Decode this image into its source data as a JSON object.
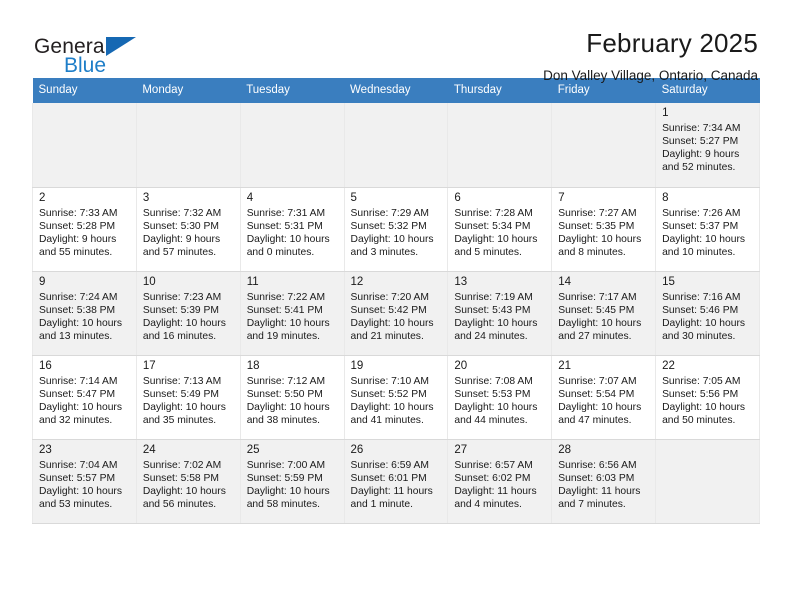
{
  "brand": {
    "name_part1": "General",
    "name_part2": "Blue",
    "accent_color": "#1668b3",
    "logo_icon": "triangle-logo-icon"
  },
  "header": {
    "title": "February 2025",
    "subtitle": "Don Valley Village, Ontario, Canada"
  },
  "theme": {
    "header_row_bg": "#3a7ebf",
    "header_row_text": "#ffffff",
    "row_shaded_bg": "#f1f1f1",
    "row_plain_bg": "#ffffff",
    "grid_border": "#d9d9d9"
  },
  "weekday_headers": [
    "Sunday",
    "Monday",
    "Tuesday",
    "Wednesday",
    "Thursday",
    "Friday",
    "Saturday"
  ],
  "calendar": {
    "month": "February",
    "year": "2025",
    "labels": {
      "sunrise": "Sunrise:",
      "sunset": "Sunset:",
      "daylight": "Daylight:"
    },
    "weeks": [
      {
        "shaded": true,
        "days": [
          {
            "day": "",
            "detail": ""
          },
          {
            "day": "",
            "detail": ""
          },
          {
            "day": "",
            "detail": ""
          },
          {
            "day": "",
            "detail": ""
          },
          {
            "day": "",
            "detail": ""
          },
          {
            "day": "",
            "detail": ""
          },
          {
            "day": "1",
            "detail": "Sunrise: 7:34 AM\nSunset: 5:27 PM\nDaylight: 9 hours\nand 52 minutes."
          }
        ]
      },
      {
        "shaded": false,
        "days": [
          {
            "day": "2",
            "detail": "Sunrise: 7:33 AM\nSunset: 5:28 PM\nDaylight: 9 hours\nand 55 minutes."
          },
          {
            "day": "3",
            "detail": "Sunrise: 7:32 AM\nSunset: 5:30 PM\nDaylight: 9 hours\nand 57 minutes."
          },
          {
            "day": "4",
            "detail": "Sunrise: 7:31 AM\nSunset: 5:31 PM\nDaylight: 10 hours\nand 0 minutes."
          },
          {
            "day": "5",
            "detail": "Sunrise: 7:29 AM\nSunset: 5:32 PM\nDaylight: 10 hours\nand 3 minutes."
          },
          {
            "day": "6",
            "detail": "Sunrise: 7:28 AM\nSunset: 5:34 PM\nDaylight: 10 hours\nand 5 minutes."
          },
          {
            "day": "7",
            "detail": "Sunrise: 7:27 AM\nSunset: 5:35 PM\nDaylight: 10 hours\nand 8 minutes."
          },
          {
            "day": "8",
            "detail": "Sunrise: 7:26 AM\nSunset: 5:37 PM\nDaylight: 10 hours\nand 10 minutes."
          }
        ]
      },
      {
        "shaded": true,
        "days": [
          {
            "day": "9",
            "detail": "Sunrise: 7:24 AM\nSunset: 5:38 PM\nDaylight: 10 hours\nand 13 minutes."
          },
          {
            "day": "10",
            "detail": "Sunrise: 7:23 AM\nSunset: 5:39 PM\nDaylight: 10 hours\nand 16 minutes."
          },
          {
            "day": "11",
            "detail": "Sunrise: 7:22 AM\nSunset: 5:41 PM\nDaylight: 10 hours\nand 19 minutes."
          },
          {
            "day": "12",
            "detail": "Sunrise: 7:20 AM\nSunset: 5:42 PM\nDaylight: 10 hours\nand 21 minutes."
          },
          {
            "day": "13",
            "detail": "Sunrise: 7:19 AM\nSunset: 5:43 PM\nDaylight: 10 hours\nand 24 minutes."
          },
          {
            "day": "14",
            "detail": "Sunrise: 7:17 AM\nSunset: 5:45 PM\nDaylight: 10 hours\nand 27 minutes."
          },
          {
            "day": "15",
            "detail": "Sunrise: 7:16 AM\nSunset: 5:46 PM\nDaylight: 10 hours\nand 30 minutes."
          }
        ]
      },
      {
        "shaded": false,
        "days": [
          {
            "day": "16",
            "detail": "Sunrise: 7:14 AM\nSunset: 5:47 PM\nDaylight: 10 hours\nand 32 minutes."
          },
          {
            "day": "17",
            "detail": "Sunrise: 7:13 AM\nSunset: 5:49 PM\nDaylight: 10 hours\nand 35 minutes."
          },
          {
            "day": "18",
            "detail": "Sunrise: 7:12 AM\nSunset: 5:50 PM\nDaylight: 10 hours\nand 38 minutes."
          },
          {
            "day": "19",
            "detail": "Sunrise: 7:10 AM\nSunset: 5:52 PM\nDaylight: 10 hours\nand 41 minutes."
          },
          {
            "day": "20",
            "detail": "Sunrise: 7:08 AM\nSunset: 5:53 PM\nDaylight: 10 hours\nand 44 minutes."
          },
          {
            "day": "21",
            "detail": "Sunrise: 7:07 AM\nSunset: 5:54 PM\nDaylight: 10 hours\nand 47 minutes."
          },
          {
            "day": "22",
            "detail": "Sunrise: 7:05 AM\nSunset: 5:56 PM\nDaylight: 10 hours\nand 50 minutes."
          }
        ]
      },
      {
        "shaded": true,
        "days": [
          {
            "day": "23",
            "detail": "Sunrise: 7:04 AM\nSunset: 5:57 PM\nDaylight: 10 hours\nand 53 minutes."
          },
          {
            "day": "24",
            "detail": "Sunrise: 7:02 AM\nSunset: 5:58 PM\nDaylight: 10 hours\nand 56 minutes."
          },
          {
            "day": "25",
            "detail": "Sunrise: 7:00 AM\nSunset: 5:59 PM\nDaylight: 10 hours\nand 58 minutes."
          },
          {
            "day": "26",
            "detail": "Sunrise: 6:59 AM\nSunset: 6:01 PM\nDaylight: 11 hours\nand 1 minute."
          },
          {
            "day": "27",
            "detail": "Sunrise: 6:57 AM\nSunset: 6:02 PM\nDaylight: 11 hours\nand 4 minutes."
          },
          {
            "day": "28",
            "detail": "Sunrise: 6:56 AM\nSunset: 6:03 PM\nDaylight: 11 hours\nand 7 minutes."
          },
          {
            "day": "",
            "detail": ""
          }
        ]
      }
    ]
  }
}
